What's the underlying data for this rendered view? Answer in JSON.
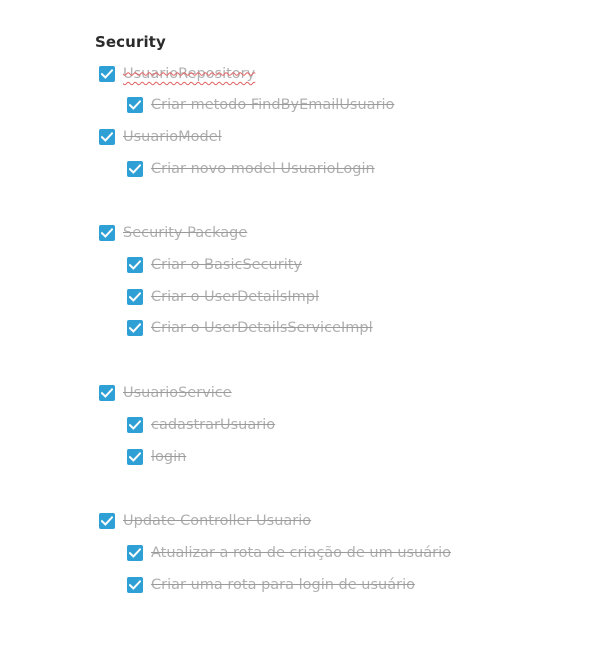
{
  "section": {
    "title": "Security"
  },
  "items": [
    {
      "label": "UsuarioRepository",
      "checked": true,
      "level": 0
    },
    {
      "label": "Criar metodo FindByEmailUsuario",
      "checked": true,
      "level": 1
    },
    {
      "label": "UsuarioModel",
      "checked": true,
      "level": 0
    },
    {
      "label": "Criar novo model UsuarioLogin",
      "checked": true,
      "level": 1
    },
    {
      "label": "Security Package",
      "checked": true,
      "level": 0
    },
    {
      "label": "Criar o BasicSecurity",
      "checked": true,
      "level": 1
    },
    {
      "label": "Criar o UserDetailsImpl",
      "checked": true,
      "level": 1
    },
    {
      "label": "Criar o UserDetailsServiceImpl",
      "checked": true,
      "level": 1
    },
    {
      "label": "UsuarioService",
      "checked": true,
      "level": 0
    },
    {
      "label": "cadastrarUsuario",
      "checked": true,
      "level": 1
    },
    {
      "label": "login",
      "checked": true,
      "level": 1
    },
    {
      "label": "Update Controller Usuario",
      "checked": true,
      "level": 0
    },
    {
      "label": "Atualizar a rota de criação de um usuário",
      "checked": true,
      "level": 1
    },
    {
      "label": "Criar uma rota para login de usuário",
      "checked": true,
      "level": 1
    }
  ],
  "colors": {
    "checkbox_fill": "#2ea0d6",
    "checkmark": "#ffffff",
    "completed_text": "#b0b0b0",
    "title_text": "#2b2b2b"
  },
  "icons": {
    "checkbox": "checkmark-icon"
  }
}
